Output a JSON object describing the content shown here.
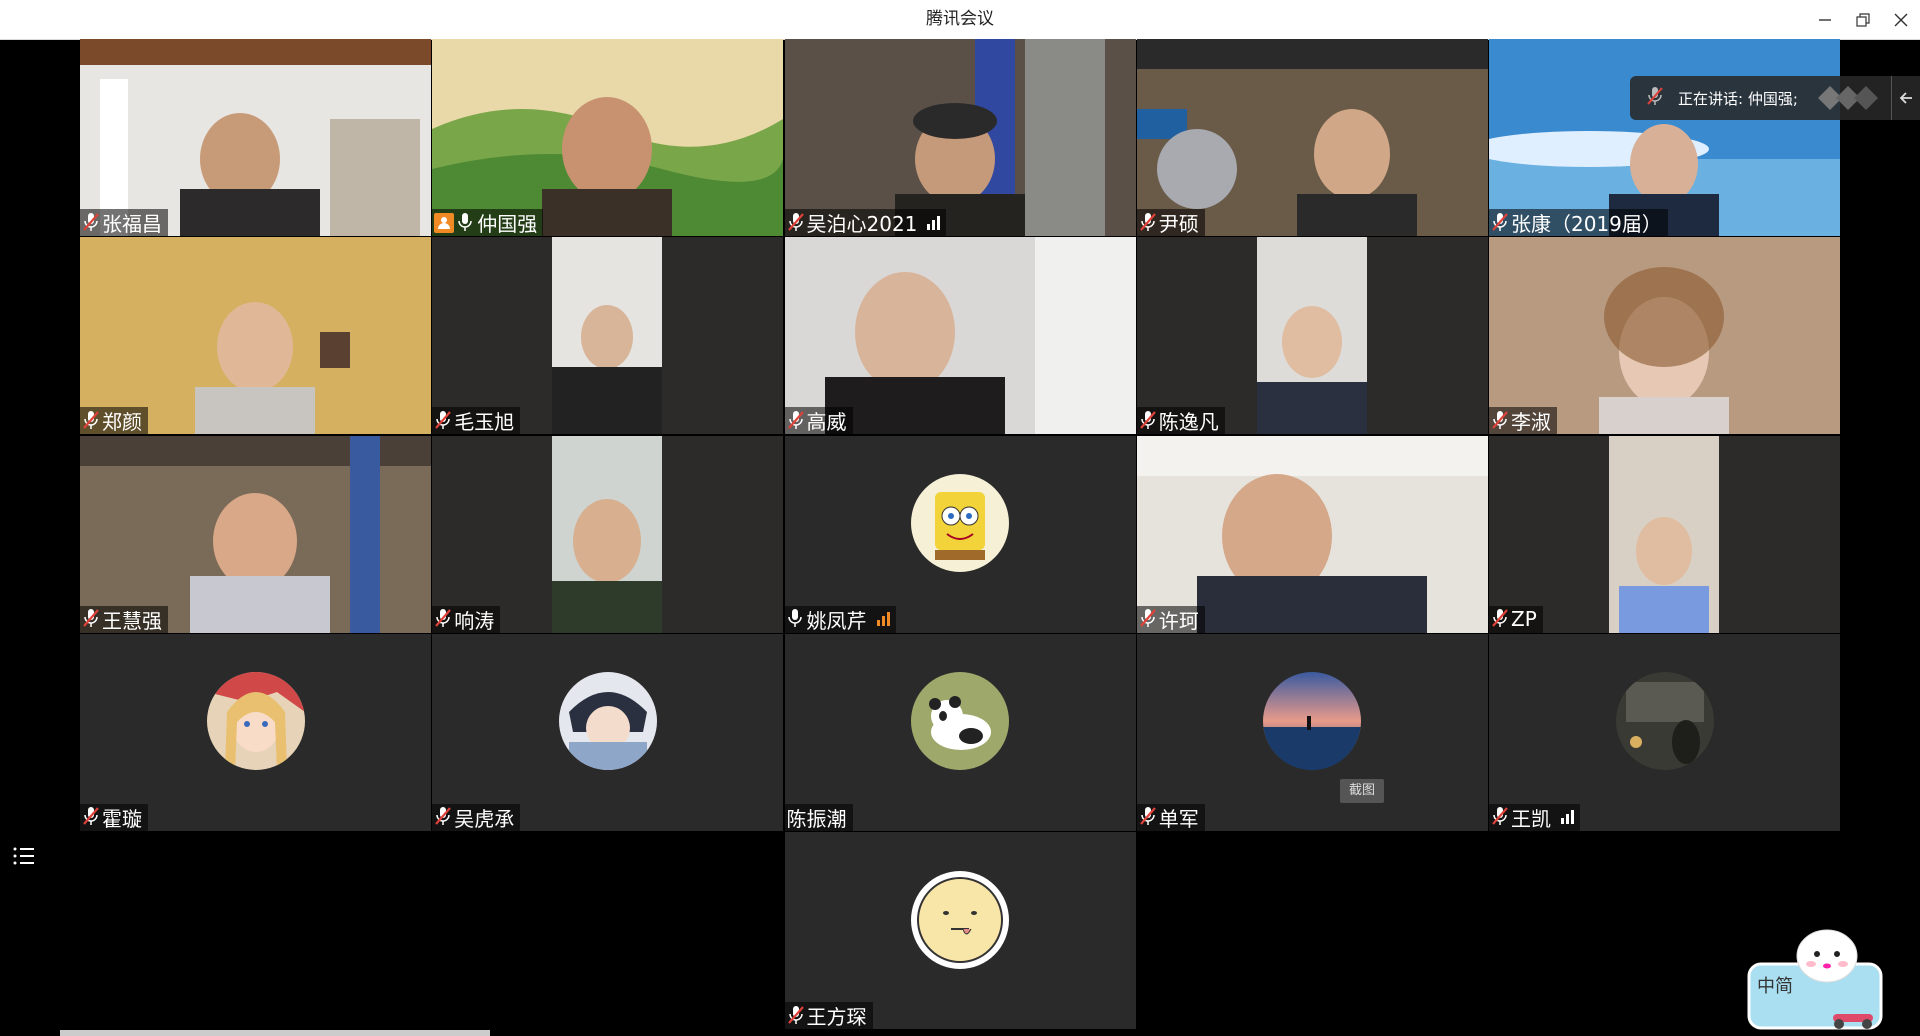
{
  "window": {
    "title": "腾讯会议",
    "controls": [
      "minimize-icon",
      "restore-icon",
      "close-icon"
    ]
  },
  "speaking": {
    "label": "正在讲话: 仲国强;"
  },
  "screenshot_tip": "截图",
  "mascot_text": "中简",
  "participants": [
    {
      "name": "张福昌",
      "mic": "muted",
      "signal": false,
      "kind": "video"
    },
    {
      "name": "仲国强",
      "mic": "on",
      "signal": false,
      "kind": "video",
      "host": true,
      "active": true
    },
    {
      "name": "吴泊心2021",
      "mic": "muted",
      "signal": true,
      "kind": "video"
    },
    {
      "name": "尹硕",
      "mic": "muted",
      "signal": false,
      "kind": "video"
    },
    {
      "name": "张康（2019届）",
      "mic": "muted",
      "signal": false,
      "kind": "video"
    },
    {
      "name": "郑颜",
      "mic": "muted",
      "signal": false,
      "kind": "video"
    },
    {
      "name": "毛玉旭",
      "mic": "muted",
      "signal": false,
      "kind": "video"
    },
    {
      "name": "高威",
      "mic": "muted",
      "signal": false,
      "kind": "video"
    },
    {
      "name": "陈逸凡",
      "mic": "muted",
      "signal": false,
      "kind": "video"
    },
    {
      "name": "李淑",
      "mic": "muted",
      "signal": false,
      "kind": "video"
    },
    {
      "name": "王慧强",
      "mic": "muted",
      "signal": false,
      "kind": "video"
    },
    {
      "name": "响涛",
      "mic": "muted",
      "signal": false,
      "kind": "video"
    },
    {
      "name": "姚凤芹",
      "mic": "on",
      "signal": true,
      "kind": "avatar",
      "avatar": "spongebob-avatar"
    },
    {
      "name": "许珂",
      "mic": "muted",
      "signal": false,
      "kind": "video"
    },
    {
      "name": "ZP",
      "mic": "muted",
      "signal": false,
      "kind": "video"
    },
    {
      "name": "霍璇",
      "mic": "muted",
      "signal": false,
      "kind": "avatar",
      "avatar": "anime-girl-avatar"
    },
    {
      "name": "吴虎承",
      "mic": "muted",
      "signal": false,
      "kind": "avatar",
      "avatar": "anime-boy-avatar"
    },
    {
      "name": "陈振潮",
      "mic": "none",
      "signal": false,
      "kind": "avatar",
      "avatar": "panda-avatar"
    },
    {
      "name": "单军",
      "mic": "muted",
      "signal": false,
      "kind": "avatar",
      "avatar": "sunset-sea-avatar"
    },
    {
      "name": "王凯",
      "mic": "muted",
      "signal": true,
      "kind": "avatar",
      "avatar": "dark-room-avatar"
    },
    {
      "name": "王方琛",
      "mic": "muted",
      "signal": false,
      "kind": "avatar",
      "avatar": "smiley-face-avatar"
    }
  ],
  "colors": {
    "background": "#000000",
    "tile": "#2a2a2a",
    "active_border": "#27a85a",
    "muted_mic": "#e0423a",
    "signal_orange": "#f08a24"
  }
}
